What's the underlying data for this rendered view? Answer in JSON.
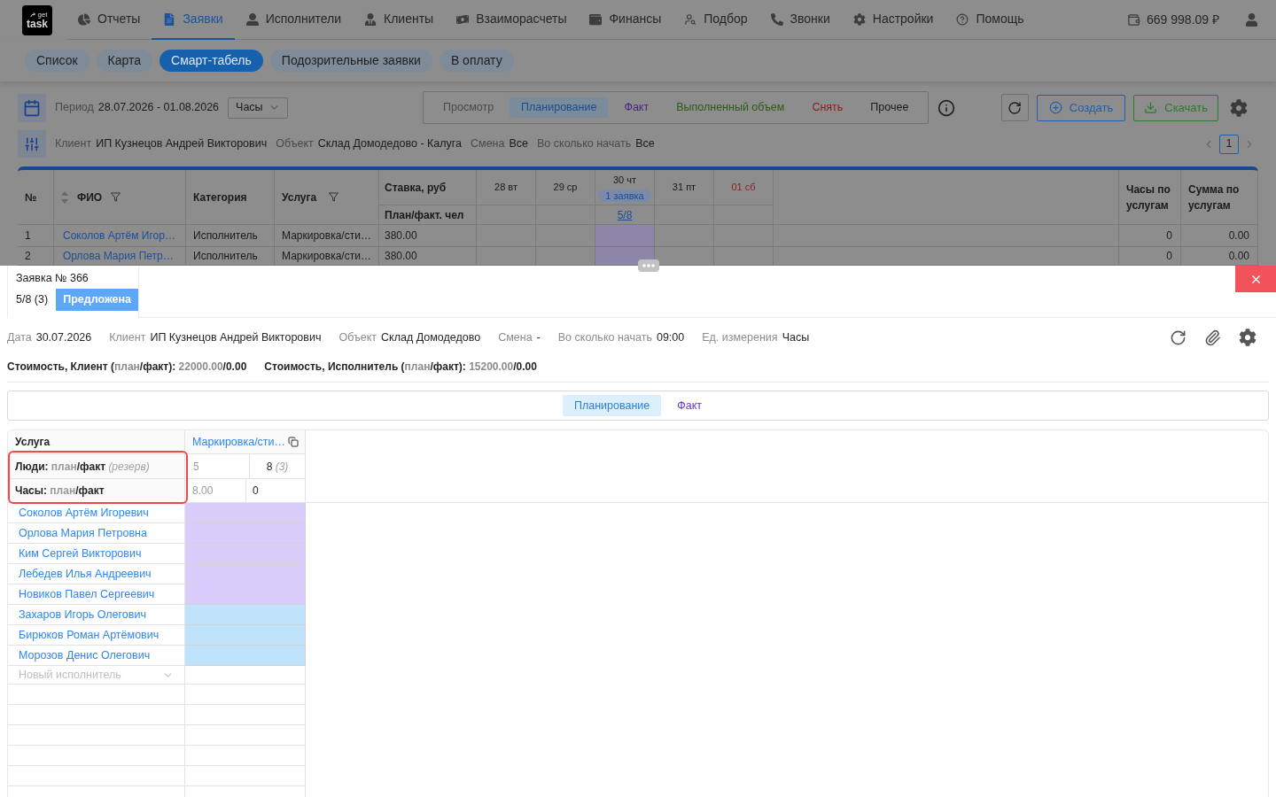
{
  "nav": {
    "logo": [
      "get",
      "task"
    ],
    "items": [
      {
        "label": "Отчеты",
        "selected": false
      },
      {
        "label": "Заявки",
        "selected": true
      },
      {
        "label": "Исполнители",
        "selected": false
      },
      {
        "label": "Клиенты",
        "selected": false
      },
      {
        "label": "Взаиморасчеты",
        "selected": false
      },
      {
        "label": "Финансы",
        "selected": false
      },
      {
        "label": "Подбор",
        "selected": false
      },
      {
        "label": "Звонки",
        "selected": false
      },
      {
        "label": "Настройки",
        "selected": false
      },
      {
        "label": "Помощь",
        "selected": false
      }
    ],
    "balance": "669 998.09 ₽"
  },
  "subtabs": [
    {
      "label": "Список",
      "selected": false
    },
    {
      "label": "Карта",
      "selected": false
    },
    {
      "label": "Смарт-табель",
      "selected": true
    },
    {
      "label": "Подозрительные заявки",
      "selected": false
    },
    {
      "label": "В оплату",
      "selected": false
    }
  ],
  "toolbar": {
    "period_label": "Период",
    "period": "28.07.2026 - 01.08.2026",
    "unit": "Часы",
    "modes": [
      {
        "label": "Просмотр",
        "selected": false,
        "color": "#4a4a4a"
      },
      {
        "label": "Планирование",
        "selected": true,
        "color": "#1a4d8a"
      },
      {
        "label": "Факт",
        "selected": false,
        "color": "#4a237a"
      },
      {
        "label": "Выполненный объем",
        "selected": false,
        "color": "#2f5a14"
      },
      {
        "label": "Снять",
        "selected": false,
        "color": "#8a1c1c"
      },
      {
        "label": "Прочее",
        "selected": false,
        "color": "#1a1a1a"
      }
    ],
    "create_label": "Создать",
    "download_label": "Скачать",
    "filters": [
      {
        "label": "Клиент",
        "value": "ИП Кузнецов Андрей Викторович"
      },
      {
        "label": "Объект",
        "value": "Склад Домодедово - Калуга"
      },
      {
        "label": "Смена",
        "value": "Все"
      },
      {
        "label": "Во сколько начать",
        "value": "Все"
      }
    ],
    "page": "1"
  },
  "table": {
    "headers": {
      "number": "№",
      "name": "ФИО",
      "category": "Категория",
      "service": "Услуга",
      "rate": "Ставка, руб",
      "plan_fact": "План/факт. чел",
      "hours": "Часы по услугам",
      "sum": "Сумма по услугам"
    },
    "days": [
      {
        "label": "28 вт",
        "weekend": false,
        "highlighted": false
      },
      {
        "label": "29 ср",
        "weekend": false,
        "highlighted": false
      },
      {
        "label": "30 чт",
        "weekend": false,
        "highlighted": true,
        "badge": "1 заявка",
        "plan_fact": "5/8"
      },
      {
        "label": "31 пт",
        "weekend": false,
        "highlighted": false
      },
      {
        "label": "01 сб",
        "weekend": true,
        "highlighted": false
      }
    ],
    "rows": [
      {
        "number": "1",
        "name": "Соколов Артём Игор…",
        "category": "Исполнитель",
        "service": "Маркировка/сти…",
        "rate": "380.00",
        "hours": "0",
        "sum": "0.00"
      },
      {
        "number": "2",
        "name": "Орлова Мария Петр…",
        "category": "Исполнитель",
        "service": "Маркировка/сти…",
        "rate": "380.00",
        "hours": "0",
        "sum": "0.00"
      }
    ]
  },
  "drawer": {
    "order": {
      "title": "Заявка № 366",
      "count": "5/8 (3)",
      "status": "Предложена"
    },
    "details": [
      {
        "label": "Дата",
        "value": "30.07.2026"
      },
      {
        "label": "Клиент",
        "value": "ИП Кузнецов Андрей Викторович"
      },
      {
        "label": "Объект",
        "value": "Склад Домодедово"
      },
      {
        "label": "Смена",
        "value": "-"
      },
      {
        "label": "Во сколько начать",
        "value": "09:00"
      },
      {
        "label": "Ед. измерения",
        "value": "Часы"
      }
    ],
    "costs": [
      {
        "parts": [
          {
            "text": "Стоимость, Клиент (",
            "muted": false
          },
          {
            "text": "план",
            "muted": true
          },
          {
            "text": "/факт): ",
            "muted": false
          },
          {
            "text": "22000.00",
            "muted": true
          },
          {
            "text": "/0.00",
            "muted": false
          }
        ]
      },
      {
        "parts": [
          {
            "text": "Стоимость, Исполнитель (",
            "muted": false
          },
          {
            "text": "план",
            "muted": true
          },
          {
            "text": "/факт): ",
            "muted": false
          },
          {
            "text": "15200.00",
            "muted": true
          },
          {
            "text": "/0.00",
            "muted": false
          }
        ]
      }
    ],
    "modes": [
      {
        "label": "Планирование",
        "selected": true
      },
      {
        "label": "Факт",
        "selected": false
      }
    ],
    "grid": {
      "header_label": "Услуга",
      "service": "Маркировка/сти…",
      "highlighted": true,
      "people": {
        "parts": [
          {
            "text": "Люди: ",
            "kind": "label"
          },
          {
            "text": "план",
            "kind": "plan"
          },
          {
            "text": "/факт ",
            "kind": "fact"
          },
          {
            "text": "(резерв)",
            "kind": "reserve"
          }
        ],
        "plan": "5",
        "fact": "8",
        "reserve": "(3)"
      },
      "hours": {
        "parts": [
          {
            "text": "Часы: ",
            "kind": "label"
          },
          {
            "text": "план",
            "kind": "plan"
          },
          {
            "text": "/факт",
            "kind": "fact"
          }
        ],
        "plan": "8.00",
        "fact": "0"
      },
      "workers": [
        {
          "name": "Соколов Артём Игоревич",
          "color": "#dacdfc"
        },
        {
          "name": "Орлова Мария Петровна",
          "color": "#dacdfc"
        },
        {
          "name": "Ким Сергей Викторович",
          "color": "#dacdfc"
        },
        {
          "name": "Лебедев Илья Андреевич",
          "color": "#dacdfc"
        },
        {
          "name": "Новиков Павел Сергеевич",
          "color": "#dacdfc"
        },
        {
          "name": "Захаров Игорь Олегович",
          "color": "#bee3fb"
        },
        {
          "name": "Бирюков Роман Артёмович",
          "color": "#bee3fb"
        },
        {
          "name": "Морозов Денис Олегович",
          "color": "#bee3fb"
        }
      ],
      "new_worker_placeholder": "Новый исполнитель"
    }
  }
}
